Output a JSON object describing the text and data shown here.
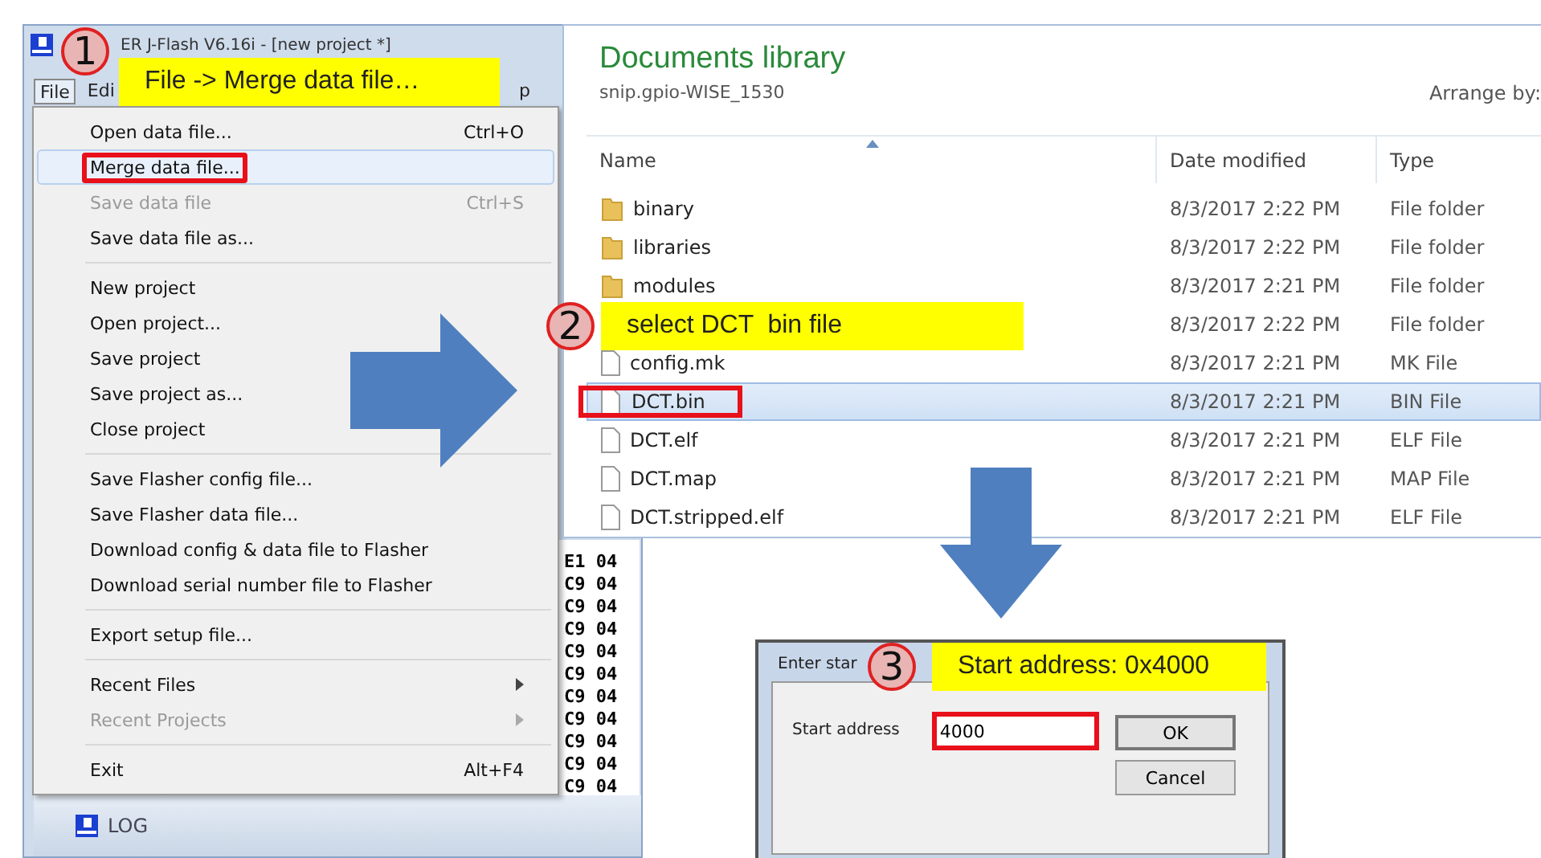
{
  "jflash": {
    "title": "ER J-Flash V6.16i - [new project *]",
    "menu_bar": [
      {
        "label": "File",
        "selected": true
      },
      {
        "label": "Edi",
        "selected": false
      },
      {
        "label": "p",
        "selected": false
      }
    ],
    "callout": {
      "number": "1",
      "text": "File -> Merge data file…"
    },
    "menu": [
      {
        "kind": "item",
        "label": "Open data file...",
        "shortcut": "Ctrl+O",
        "disabled": false,
        "selected": false,
        "highlighted": false,
        "submenu": false
      },
      {
        "kind": "item",
        "label": "Merge data file...",
        "disabled": false,
        "selected": true,
        "highlighted": true,
        "submenu": false
      },
      {
        "kind": "item",
        "label": "Save data file",
        "shortcut": "Ctrl+S",
        "disabled": true,
        "selected": false,
        "highlighted": false,
        "submenu": false
      },
      {
        "kind": "item",
        "label": "Save data file as...",
        "disabled": false,
        "selected": false,
        "highlighted": false,
        "submenu": false
      },
      {
        "kind": "separator"
      },
      {
        "kind": "item",
        "label": "New project",
        "disabled": false,
        "selected": false,
        "highlighted": false,
        "submenu": false
      },
      {
        "kind": "item",
        "label": "Open project...",
        "disabled": false,
        "selected": false,
        "highlighted": false,
        "submenu": false
      },
      {
        "kind": "item",
        "label": "Save project",
        "disabled": false,
        "selected": false,
        "highlighted": false,
        "submenu": false
      },
      {
        "kind": "item",
        "label": "Save project as...",
        "disabled": false,
        "selected": false,
        "highlighted": false,
        "submenu": false
      },
      {
        "kind": "item",
        "label": "Close project",
        "disabled": false,
        "selected": false,
        "highlighted": false,
        "submenu": false
      },
      {
        "kind": "separator"
      },
      {
        "kind": "item",
        "label": "Save Flasher config file...",
        "disabled": false,
        "selected": false,
        "highlighted": false,
        "submenu": false
      },
      {
        "kind": "item",
        "label": "Save Flasher data file...",
        "disabled": false,
        "selected": false,
        "highlighted": false,
        "submenu": false
      },
      {
        "kind": "item",
        "label": "Download config & data file to Flasher",
        "disabled": false,
        "selected": false,
        "highlighted": false,
        "submenu": false
      },
      {
        "kind": "item",
        "label": "Download serial number file to Flasher",
        "disabled": false,
        "selected": false,
        "highlighted": false,
        "submenu": false
      },
      {
        "kind": "separator"
      },
      {
        "kind": "item",
        "label": "Export setup file...",
        "disabled": false,
        "selected": false,
        "highlighted": false,
        "submenu": false
      },
      {
        "kind": "separator"
      },
      {
        "kind": "item",
        "label": "Recent Files",
        "disabled": false,
        "selected": false,
        "highlighted": false,
        "submenu": true
      },
      {
        "kind": "item",
        "label": "Recent Projects",
        "disabled": true,
        "selected": false,
        "highlighted": false,
        "submenu": true
      },
      {
        "kind": "separator"
      },
      {
        "kind": "item",
        "label": "Exit",
        "shortcut": "Alt+F4",
        "disabled": false,
        "selected": false,
        "highlighted": false,
        "submenu": false
      }
    ],
    "hex_rows": [
      "E1 04",
      "C9 04",
      "C9 04",
      "C9 04",
      "C9 04",
      "C9 04",
      "C9 04",
      "C9 04",
      "C9 04",
      "C9 04",
      "C9 04"
    ],
    "log_label": "LOG"
  },
  "explorer": {
    "title": "Documents library",
    "subtitle": "snip.gpio-WISE_1530",
    "arrange_label": "Arrange by:",
    "columns": [
      "Name",
      "Date modified",
      "Type"
    ],
    "callout": {
      "number": "2",
      "text": "select DCT  bin file"
    },
    "rows": [
      {
        "kind": "folder",
        "name": "binary",
        "date": "8/3/2017 2:22 PM",
        "type": "File folder",
        "selected": false,
        "highlighted": false
      },
      {
        "kind": "folder",
        "name": "libraries",
        "date": "8/3/2017 2:22 PM",
        "type": "File folder",
        "selected": false,
        "highlighted": false
      },
      {
        "kind": "folder",
        "name": "modules",
        "date": "8/3/2017 2:21 PM",
        "type": "File folder",
        "selected": false,
        "highlighted": false
      },
      {
        "kind": "folder",
        "date": "8/3/2017 2:22 PM",
        "type": "File folder",
        "selected": false
      },
      {
        "kind": "file",
        "name": "config.mk",
        "date": "8/3/2017 2:21 PM",
        "type": "MK File",
        "selected": false,
        "highlighted": false
      },
      {
        "kind": "file",
        "name": "DCT.bin",
        "date": "8/3/2017 2:21 PM",
        "type": "BIN File",
        "selected": true,
        "highlighted": true
      },
      {
        "kind": "file",
        "name": "DCT.elf",
        "date": "8/3/2017 2:21 PM",
        "type": "ELF File",
        "selected": false,
        "highlighted": false
      },
      {
        "kind": "file",
        "name": "DCT.map",
        "date": "8/3/2017 2:21 PM",
        "type": "MAP File",
        "selected": false,
        "highlighted": false
      },
      {
        "kind": "file",
        "name": "DCT.stripped.elf",
        "date": "8/3/2017 2:21 PM",
        "type": "ELF File",
        "selected": false,
        "highlighted": false
      }
    ]
  },
  "dialog": {
    "title": "Enter star",
    "callout": {
      "number": "3",
      "text": "Start address: 0x4000"
    },
    "field_label": "Start address",
    "field_value": "4000",
    "field_highlighted": true,
    "buttons": [
      "OK",
      "Cancel"
    ]
  }
}
